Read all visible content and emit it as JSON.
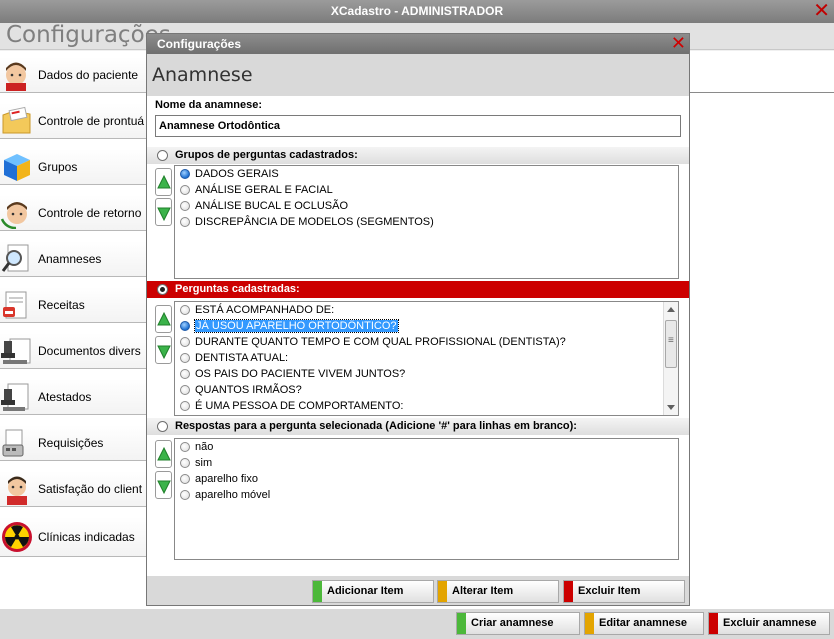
{
  "window": {
    "title": "XCadastro - ADMINISTRADOR",
    "close_glyph": "✕"
  },
  "main": {
    "title": "Configurações"
  },
  "sidebar": {
    "items": [
      {
        "label": "Dados do paciente",
        "icon": "patient-face-icon"
      },
      {
        "label": "Controle de prontuá",
        "icon": "folder-record-icon"
      },
      {
        "label": "Grupos",
        "icon": "cube-icon"
      },
      {
        "label": "Controle de retorno",
        "icon": "patient-return-icon"
      },
      {
        "label": "Anamneses",
        "icon": "magnifier-document-icon"
      },
      {
        "label": "Receitas",
        "icon": "prescription-icon"
      },
      {
        "label": "Documentos divers",
        "icon": "stamp-document-icon"
      },
      {
        "label": "Atestados",
        "icon": "stamp-icon"
      },
      {
        "label": "Requisições",
        "icon": "register-document-icon"
      },
      {
        "label": "Satisfação do client",
        "icon": "person-face-icon"
      },
      {
        "label": "Clínicas indicadas",
        "icon": "radiation-icon"
      }
    ]
  },
  "dialog": {
    "title": "Configurações",
    "heading": "Anamnese",
    "name_label": "Nome da anamnese:",
    "name_value": "Anamnese Ortodôntica",
    "groups": {
      "label": "Grupos de perguntas cadastrados:",
      "items": [
        "DADOS GERAIS",
        "ANÁLISE GERAL E FACIAL",
        "ANÁLISE BUCAL E OCLUSÃO",
        "DISCREPÂNCIA DE MODELOS (SEGMENTOS)"
      ],
      "selected_index": 0
    },
    "questions": {
      "label": "Perguntas cadastradas:",
      "items": [
        "ESTÁ ACOMPANHADO DE:",
        "JÁ USOU APARELHO ORTODÔNTICO?",
        "DURANTE QUANTO TEMPO E COM QUAL PROFISSIONAL (DENTISTA)?",
        "DENTISTA ATUAL:",
        "OS PAIS DO PACIENTE VIVEM JUNTOS?",
        "QUANTOS IRMÃOS?",
        "É UMA PESSOA DE COMPORTAMENTO:"
      ],
      "selected_index": 1
    },
    "answers": {
      "label": "Respostas para a pergunta selecionada (Adicione '#' para linhas em branco):",
      "items": [
        "não",
        "sim",
        "aparelho fixo",
        "aparelho móvel"
      ]
    },
    "buttons": {
      "add": "Adicionar Item",
      "edit": "Alterar Item",
      "delete": "Excluir Item"
    }
  },
  "bottom": {
    "create": "Criar anamnese",
    "edit": "Editar anamnese",
    "delete": "Excluir anamnese"
  },
  "colors": {
    "green": "#4cb83a",
    "yellow": "#e3a400",
    "red": "#cc0000",
    "selection": "#3399ff"
  }
}
